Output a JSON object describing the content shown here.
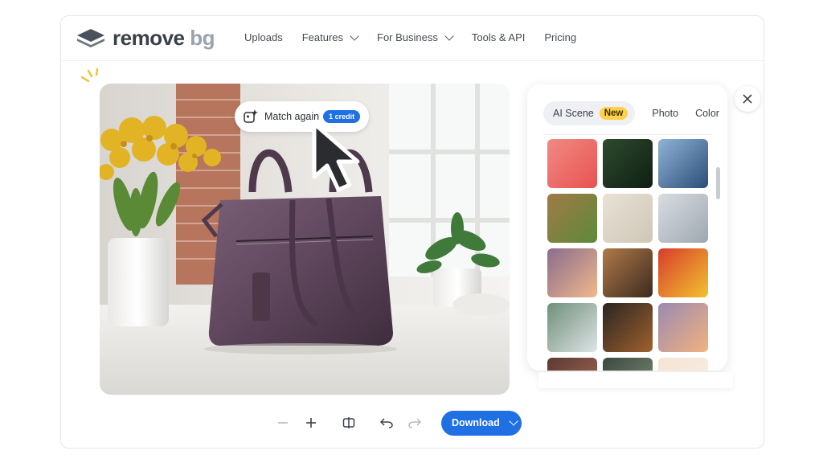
{
  "brand": {
    "name_primary": "remove",
    "name_secondary": "bg"
  },
  "nav": {
    "items": [
      {
        "label": "Uploads",
        "has_dropdown": false
      },
      {
        "label": "Features",
        "has_dropdown": true
      },
      {
        "label": "For Business",
        "has_dropdown": true
      },
      {
        "label": "Tools & API",
        "has_dropdown": false
      },
      {
        "label": "Pricing",
        "has_dropdown": false
      }
    ]
  },
  "editor": {
    "match_again": {
      "label": "Match again",
      "credit_badge": "1 credit",
      "icon": "sparkle-image-icon"
    }
  },
  "background_panel": {
    "tabs": [
      {
        "label": "AI Scene",
        "badge": "New",
        "active": true
      },
      {
        "label": "Photo",
        "active": false
      },
      {
        "label": "Color",
        "active": false
      }
    ],
    "thumbnails": [
      {
        "name": "pink-bokeh",
        "colors": [
          "#f08a86",
          "#e9524f"
        ]
      },
      {
        "name": "green-dewdrops",
        "colors": [
          "#2e4a2f",
          "#0f1f12"
        ]
      },
      {
        "name": "glacier-ice",
        "colors": [
          "#8fb4d6",
          "#2b4d79"
        ]
      },
      {
        "name": "wooden-cabin",
        "colors": [
          "#a07a45",
          "#5d8a3a"
        ]
      },
      {
        "name": "cream-fabric",
        "colors": [
          "#e8e2d6",
          "#cfc6b6"
        ]
      },
      {
        "name": "modern-kitchen",
        "colors": [
          "#d9dde2",
          "#9ea7b0"
        ]
      },
      {
        "name": "peach-gradient",
        "colors": [
          "#8a6c8e",
          "#f0b88a"
        ]
      },
      {
        "name": "cafe-pastry",
        "colors": [
          "#b07a4a",
          "#3c2a1e"
        ]
      },
      {
        "name": "color-stripes",
        "colors": [
          "#d73c2c",
          "#f2c22e"
        ]
      },
      {
        "name": "tea-table",
        "colors": [
          "#6f8f7a",
          "#dde4e6"
        ]
      },
      {
        "name": "leather-shoes",
        "colors": [
          "#2a2522",
          "#a0612e"
        ]
      },
      {
        "name": "sunset-sky",
        "colors": [
          "#9a8ab0",
          "#f2b27f"
        ]
      },
      {
        "name": "dark-interior",
        "colors": [
          "#5c3a34",
          "#a56a55"
        ]
      },
      {
        "name": "green-bridge",
        "colors": [
          "#3c4a3d",
          "#7f8c7d"
        ]
      },
      {
        "name": "pale-peach",
        "colors": [
          "#f4e4d4",
          "#f9efe3"
        ]
      }
    ]
  },
  "toolbar": {
    "zoom_out_icon": "minus-icon",
    "zoom_in_icon": "plus-icon",
    "compare_icon": "compare-icon",
    "undo_icon": "undo-icon",
    "redo_icon": "redo-icon",
    "download_label": "Download"
  },
  "colors": {
    "accent": "#1f6fe5",
    "new_badge": "#ffd24a"
  }
}
